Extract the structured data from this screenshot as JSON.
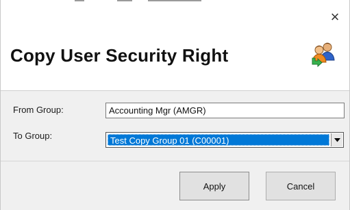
{
  "window": {
    "close_glyph": "×"
  },
  "header": {
    "title": "Copy User Security Right",
    "icon": "users-copy-icon"
  },
  "form": {
    "from_group_label": "From Group:",
    "from_group_value": "Accounting Mgr (AMGR)",
    "to_group_label": "To Group:",
    "to_group_selected": "Test Copy Group 01 (C00001)"
  },
  "buttons": {
    "apply_label": "Apply",
    "cancel_label": "Cancel"
  },
  "colors": {
    "selection": "#0078d7",
    "background": "#f0f0f0",
    "header_background": "#ffffff"
  }
}
